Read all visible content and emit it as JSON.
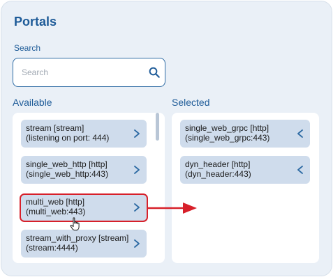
{
  "header": {
    "title": "Portals"
  },
  "search": {
    "label": "Search",
    "placeholder": "Search",
    "value": ""
  },
  "available": {
    "label": "Available",
    "items": [
      {
        "line1": "stream [stream]",
        "line2": "(listening on port: 444)"
      },
      {
        "line1": "single_web_http [http]",
        "line2": "(single_web_http:443)"
      },
      {
        "line1": "multi_web [http]",
        "line2": "(multi_web:443)"
      },
      {
        "line1": "stream_with_proxy [stream]",
        "line2": "(stream:4444)"
      }
    ]
  },
  "selected": {
    "label": "Selected",
    "items": [
      {
        "line1": "single_web_grpc [http]",
        "line2": "(single_web_grpc:443)"
      },
      {
        "line1": "dyn_header [http]",
        "line2": "(dyn_header:443)"
      }
    ]
  },
  "colors": {
    "accent": "#1e5b98",
    "panel_bg": "#eaf0f7",
    "item_bg": "#cfdcec",
    "highlight": "#d7202a"
  },
  "icons": {
    "search": "search-icon",
    "move_right": "chevron-right-icon",
    "move_left": "chevron-left-icon",
    "pointer": "hand-cursor-icon"
  }
}
